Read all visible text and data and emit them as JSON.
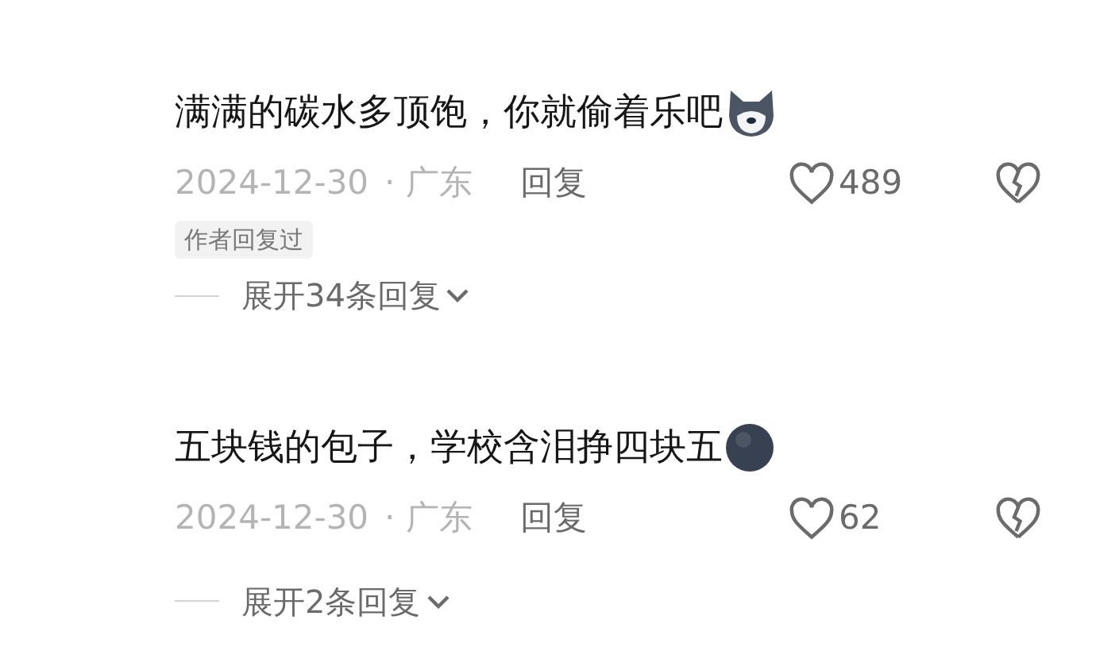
{
  "comments": [
    {
      "text": "满满的碳水多顶饱，你就偷着乐吧",
      "emoji": {
        "kind": "dog"
      },
      "date": "2024-12-30",
      "location": "· 广东",
      "reply": "回复",
      "likes": "489",
      "badge": "作者回复过",
      "expand": "展开34条回复"
    },
    {
      "text": "五块钱的包子，学校含泪挣四块五",
      "emoji": {
        "kind": "dark"
      },
      "date": "2024-12-30",
      "location": "· 广东",
      "reply": "回复",
      "likes": "62",
      "expand": "展开2条回复"
    }
  ]
}
